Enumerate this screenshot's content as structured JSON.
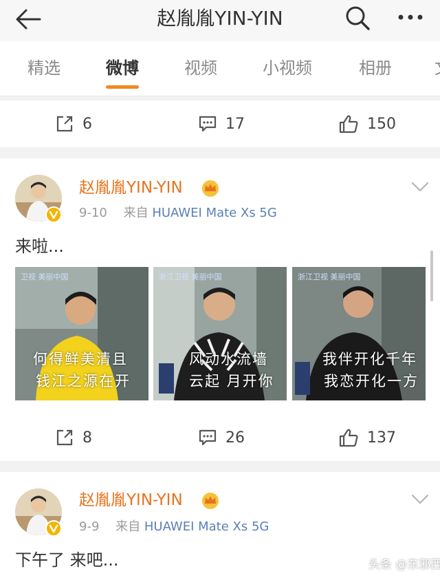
{
  "header": {
    "title": "赵胤胤YIN-YIN",
    "back_icon": "back-arrow-icon",
    "search_icon": "search-icon",
    "more_icon": "more-icon"
  },
  "tabs": [
    {
      "label": "精选",
      "active": false
    },
    {
      "label": "微博",
      "active": true
    },
    {
      "label": "视频",
      "active": false
    },
    {
      "label": "小视频",
      "active": false
    },
    {
      "label": "相册",
      "active": false
    },
    {
      "label": "文",
      "active": false
    }
  ],
  "prev_post_actions": {
    "share": "6",
    "comment": "17",
    "like": "150"
  },
  "posts": [
    {
      "author": "赵胤胤YIN-YIN",
      "date": "9-10",
      "from_label": "来自",
      "source": "HUAWEI Mate Xs 5G",
      "text": "来啦...",
      "images": [
        {
          "caption_line1": "何得鲜美清且",
          "caption_line2": "钱江之源在开"
        },
        {
          "caption_line1": "风动水流墙",
          "caption_line2": "云起 月开你"
        },
        {
          "caption_line1": "我伴开化千年",
          "caption_line2": "我恋开化一方"
        }
      ],
      "actions": {
        "share": "8",
        "comment": "26",
        "like": "137"
      }
    },
    {
      "author": "赵胤胤YIN-YIN",
      "date": "9-9",
      "from_label": "来自",
      "source": "HUAWEI Mate Xs 5G",
      "text": "下午了 来吧..."
    }
  ],
  "watermark": "头条 @东邪西媚",
  "colors": {
    "accent": "#f28a20",
    "author": "#e8731c",
    "source": "#5b7fb5"
  }
}
